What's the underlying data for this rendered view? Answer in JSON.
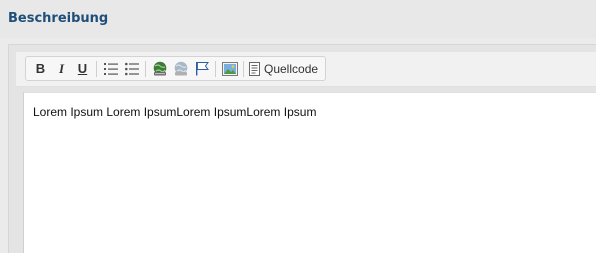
{
  "section": {
    "title": "Beschreibung"
  },
  "toolbar": {
    "bold_label": "B",
    "italic_label": "I",
    "underline_label": "U",
    "source_label": "Quellcode",
    "icons": [
      "bold",
      "italic",
      "underline",
      "numbered-list",
      "bullet-list",
      "link",
      "unlink",
      "anchor-flag",
      "image",
      "source-document"
    ]
  },
  "editor": {
    "content": "Lorem Ipsum Lorem IpsumLorem IpsumLorem Ipsum"
  },
  "colors": {
    "title": "#1f4e79",
    "background": "#ebebeb",
    "editor_bg": "#ffffff"
  }
}
